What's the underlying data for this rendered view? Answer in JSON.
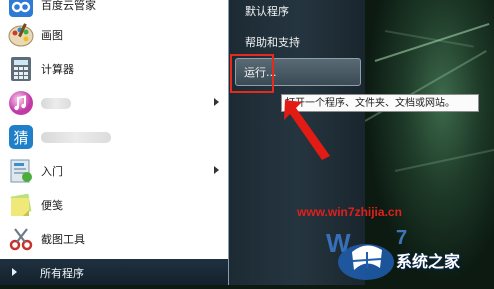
{
  "left_menu": {
    "items": [
      {
        "label": "百度云管家",
        "icon": "baidu-cloud-icon",
        "submenu": false
      },
      {
        "label": "画图",
        "icon": "paint-icon",
        "submenu": false
      },
      {
        "label": "计算器",
        "icon": "calculator-icon",
        "submenu": false
      },
      {
        "label": "",
        "icon": "itunes-icon",
        "submenu": true
      },
      {
        "label": "",
        "icon": "input-method-icon",
        "submenu": false
      },
      {
        "label": "入门",
        "icon": "getting-started-icon",
        "submenu": true
      },
      {
        "label": "便笺",
        "icon": "sticky-notes-icon",
        "submenu": false
      },
      {
        "label": "截图工具",
        "icon": "snipping-tool-icon",
        "submenu": false
      }
    ],
    "all_programs": "所有程序"
  },
  "right_menu": {
    "default_programs": "默认程序",
    "help": "帮助和支持",
    "run": "运行..."
  },
  "tooltip": "打开一个程序、文件夹、文档或网站。",
  "watermark": {
    "url": "www.win7zhijia.cn",
    "site_name": "系统之家"
  },
  "colors": {
    "highlight_box": "#e52a1e",
    "menu_right_bg": "#25353f",
    "bottom_bar": "#1f3140"
  }
}
